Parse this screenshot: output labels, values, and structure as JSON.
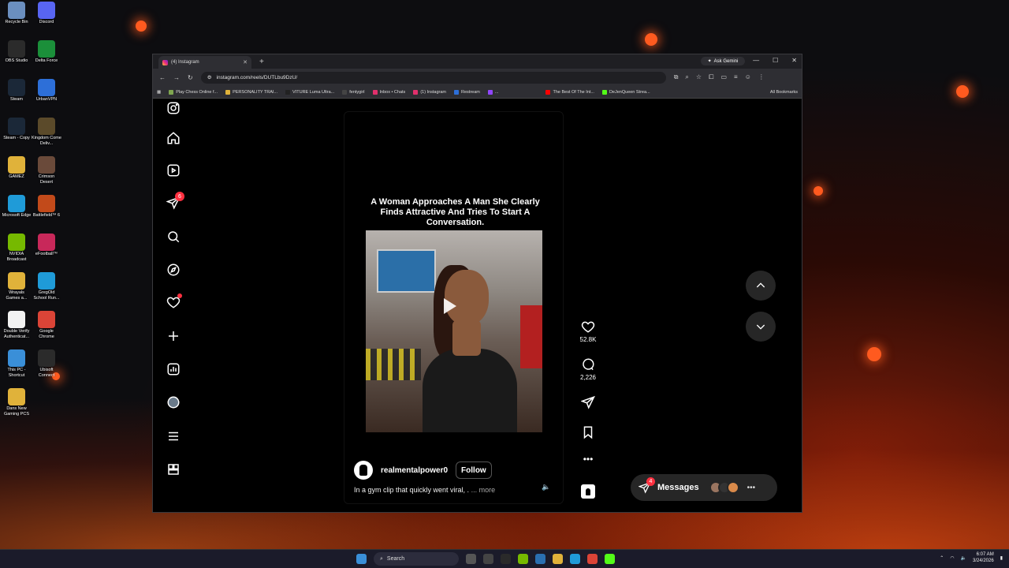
{
  "desktop": {
    "icons": [
      {
        "label": "Recycle Bin",
        "icon": "recycle-bin-icon",
        "color": "#6b8fbf"
      },
      {
        "label": "Discord",
        "icon": "discord-icon",
        "color": "#5865f2"
      },
      {
        "label": "OBS Studio",
        "icon": "obs-icon",
        "color": "#2b2b2b"
      },
      {
        "label": "Delta Force",
        "icon": "delta-force-icon",
        "color": "#1b8f3a"
      },
      {
        "label": "Steam",
        "icon": "steam-icon",
        "color": "#1b2838"
      },
      {
        "label": "UrbanVPN",
        "icon": "urbanvpn-icon",
        "color": "#2d6fd8"
      },
      {
        "label": "Steam - Copy",
        "icon": "steam-icon",
        "color": "#1b2838"
      },
      {
        "label": "Kingdom Come Deliv...",
        "icon": "kingdom-come-icon",
        "color": "#5b4a2a"
      },
      {
        "label": "GAMEZ",
        "icon": "folder-icon",
        "color": "#e0b23a"
      },
      {
        "label": "Crimson Desert",
        "icon": "crimson-desert-icon",
        "color": "#6a4a3a"
      },
      {
        "label": "Microsoft Edge",
        "icon": "edge-icon",
        "color": "#1f9bd8"
      },
      {
        "label": "Battlefield™ 6",
        "icon": "battlefield-icon",
        "color": "#c24a1a"
      },
      {
        "label": "NVIDIA Broadcast",
        "icon": "nvidia-icon",
        "color": "#76b900"
      },
      {
        "label": "eFootball™",
        "icon": "efootball-icon",
        "color": "#c8285a"
      },
      {
        "label": "Wrayals Games a...",
        "icon": "shortcut-icon",
        "color": "#e0b23a"
      },
      {
        "label": "GregOld School Run...",
        "icon": "edge-icon",
        "color": "#1f9bd8"
      },
      {
        "label": "Double Verify Authenticat...",
        "icon": "document-icon",
        "color": "#f2f2f2"
      },
      {
        "label": "Google Chrome",
        "icon": "chrome-icon",
        "color": "#db4437"
      },
      {
        "label": "This PC - Shortcut",
        "icon": "this-pc-icon",
        "color": "#3a8fd8"
      },
      {
        "label": "Ubisoft Connect",
        "icon": "ubisoft-icon",
        "color": "#2b2b2b"
      },
      {
        "label": "Dans New Gaming PCS",
        "icon": "folder-icon",
        "color": "#e0b23a"
      }
    ]
  },
  "browser": {
    "tab_title": "(4) Instagram",
    "new_tab": "+",
    "ask_gemini": "Ask Gemini",
    "url": "instagram.com/reels/DUTLbu9DzU/",
    "bookmarks": [
      {
        "label": "Play Chess Online f...",
        "color": "#7fa650"
      },
      {
        "label": "PERSONALITY TRAI...",
        "color": "#e0b23a"
      },
      {
        "label": "VITURE Luma Ultra...",
        "color": "#222222"
      },
      {
        "label": "fentygirl",
        "color": "#444444"
      },
      {
        "label": "Inbox • Chats",
        "color": "#e1306c"
      },
      {
        "label": "(1) Instagram",
        "color": "#e1306c"
      },
      {
        "label": "Restream",
        "color": "#2d6fd8"
      },
      {
        "label": "...",
        "color": "#9146ff"
      },
      {
        "label": "The Best Of The Int...",
        "color": "#ff0000"
      },
      {
        "label": "DeJenQueen Strea...",
        "color": "#53fc18"
      }
    ],
    "all_bookmarks": "All Bookmarks"
  },
  "instagram": {
    "sidebar": [
      {
        "name": "instagram-logo-icon",
        "badge": ""
      },
      {
        "name": "home-icon",
        "badge": ""
      },
      {
        "name": "reels-icon",
        "badge": ""
      },
      {
        "name": "direct-messages-icon",
        "badge": "6"
      },
      {
        "name": "search-icon",
        "badge": ""
      },
      {
        "name": "explore-icon",
        "badge": ""
      },
      {
        "name": "notifications-icon",
        "badge": "dot"
      },
      {
        "name": "create-icon",
        "badge": ""
      },
      {
        "name": "dashboard-icon",
        "badge": ""
      },
      {
        "name": "profile-avatar",
        "badge": ""
      },
      {
        "name": "menu-icon",
        "badge": ""
      },
      {
        "name": "also-from-meta-icon",
        "badge": ""
      }
    ],
    "reel": {
      "title": "A Woman Approaches A Man She Clearly Finds Attractive And Tries To Start A Conversation.",
      "username": "realmentalpower0",
      "follow_label": "Follow",
      "caption": "In a gym clip that quickly went viral, .",
      "more_label": "... more",
      "likes": "52.8K",
      "comments": "2,226"
    },
    "messages": {
      "label": "Messages",
      "badge": "4"
    }
  },
  "taskbar": {
    "search_placeholder": "Search",
    "time": "6:07 AM",
    "date": "3/24/2026"
  },
  "colors": {
    "ig_red": "#ff3040",
    "ig_dark": "#262626",
    "browser_chrome": "#2e2e33"
  }
}
